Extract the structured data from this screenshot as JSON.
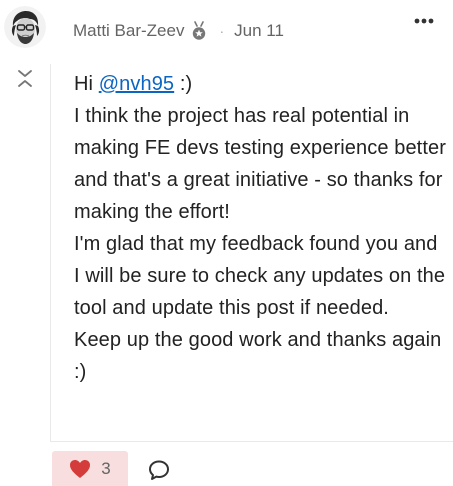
{
  "post": {
    "author": "Matti Bar-Zeev",
    "separator": "·",
    "date": "Jun 11",
    "body": {
      "greeting": "Hi",
      "mention": "@nvh95",
      "greeting_suffix": " :)",
      "paragraph": "I think the project has real potential in making FE devs testing experience better and that's a great initiative - so thanks for making the effort!",
      "paragraph2": "I'm glad that my feedback found you and I will be sure to check any updates on the tool and update this post if needed.",
      "paragraph3": "Keep up the good work and thanks again :)"
    },
    "likes": "3"
  },
  "icons": {
    "avatar": "avatar-image",
    "badge": "award-badge-icon",
    "more": "more-horizontal-icon",
    "collapse": "collapse-chevrons-icon",
    "like": "heart-icon",
    "reply": "comment-bubble-icon"
  },
  "colors": {
    "mention": "#0a66c2",
    "like_bg": "#f8dede",
    "heart": "#d43c3c",
    "muted": "#646464"
  }
}
